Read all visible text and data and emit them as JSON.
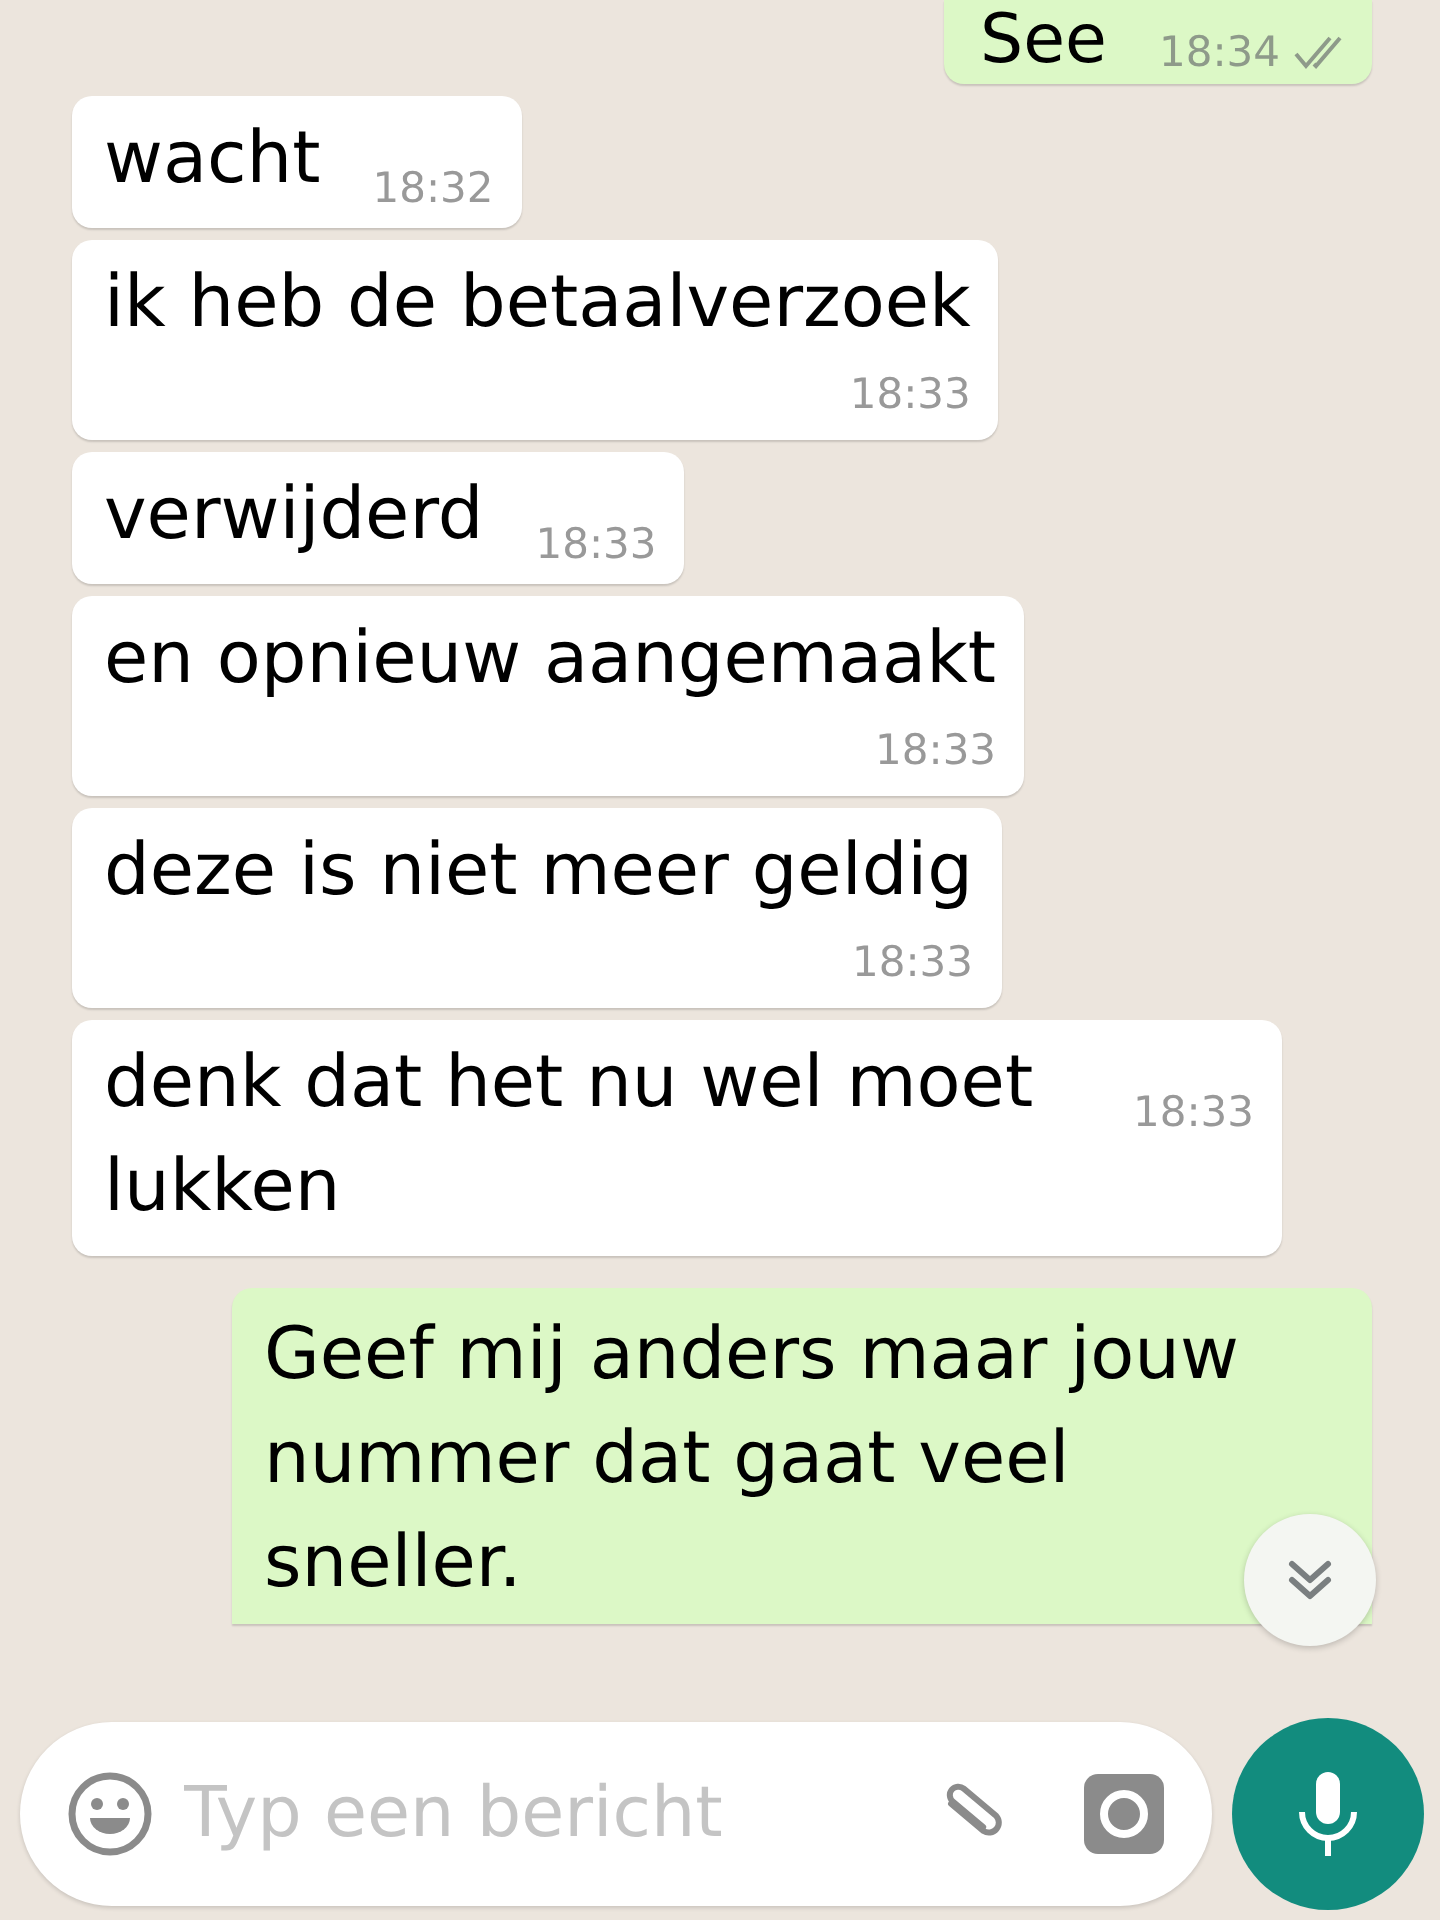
{
  "messages": [
    {
      "outgoing": true,
      "kind": "inline",
      "text": "See",
      "time": "18:34",
      "read": false
    },
    {
      "outgoing": false,
      "kind": "inline",
      "text": "wacht",
      "time": "18:32"
    },
    {
      "outgoing": false,
      "kind": "below",
      "text": "ik heb de betaalverzoek",
      "time": "18:33"
    },
    {
      "outgoing": false,
      "kind": "inline",
      "text": "verwijderd",
      "time": "18:33"
    },
    {
      "outgoing": false,
      "kind": "below",
      "text": "en opnieuw aangemaakt",
      "time": "18:33"
    },
    {
      "outgoing": false,
      "kind": "below",
      "text": "deze is niet meer geldig",
      "time": "18:33"
    },
    {
      "outgoing": false,
      "kind": "inline",
      "text": "denk dat het nu wel moet lukken",
      "time": "18:33"
    },
    {
      "outgoing": true,
      "kind": "cut",
      "text": "Geef mij anders maar jouw nummer dat gaat veel sneller."
    }
  ],
  "composer": {
    "placeholder": "Typ een bericht"
  }
}
